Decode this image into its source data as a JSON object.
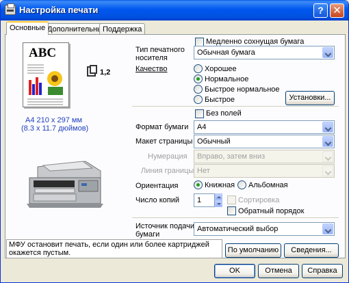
{
  "window": {
    "title": "Настройка печати",
    "help_glyph": "?",
    "close_glyph": "✕"
  },
  "tabs": [
    {
      "label": "Основные",
      "active": true
    },
    {
      "label": "Дополнительные",
      "active": false
    },
    {
      "label": "Поддержка",
      "active": false
    }
  ],
  "preview": {
    "page_text": "ABC",
    "copies_label": "1,2",
    "paper_size_mm": "A4 210 x 297 мм",
    "paper_size_in": "(8.3 x 11.7 дюймов)"
  },
  "settings": {
    "slow_dry": {
      "label": "Медленно сохнущая бумага",
      "checked": false
    },
    "media_type": {
      "label_line1": "Тип печатного",
      "label_line2": "носителя",
      "value": "Обычная бумага"
    },
    "quality": {
      "label": "Качество",
      "options": [
        "Хорошее",
        "Нормальное",
        "Быстрое нормальное",
        "Быстрое"
      ],
      "selected": "Нормальное",
      "settings_button": "Установки..."
    },
    "borderless": {
      "label": "Без полей",
      "checked": false
    },
    "paper_size": {
      "label": "Формат бумаги",
      "value": "A4"
    },
    "page_layout": {
      "label": "Макет страницы",
      "value": "Обычный"
    },
    "page_order": {
      "label": "Нумерация",
      "value": "Вправо, затем вниз"
    },
    "border_line": {
      "label": "Линия границы",
      "value": "Нет"
    },
    "orientation": {
      "label": "Ориентация",
      "options": [
        "Книжная",
        "Альбомная"
      ],
      "selected": "Книжная"
    },
    "copies": {
      "label": "Число копий",
      "value": "1",
      "collate": {
        "label": "Сортировка",
        "checked": false
      },
      "reverse": {
        "label": "Обратный порядок",
        "checked": false
      }
    },
    "paper_source": {
      "label_line1": "Источник подачи",
      "label_line2": "бумаги",
      "value": "Автоматический выбор"
    }
  },
  "status_message": "МФУ остановит печать, если один или более картриджей окажется пустым.",
  "buttons": {
    "default": "По умолчанию",
    "info": "Сведения...",
    "ok": "OK",
    "cancel": "Отмена",
    "help": "Справка"
  },
  "colors": {
    "title_bar": "#0058EE",
    "dialog_bg": "#ECE9D8",
    "radio_dot": "#21A121",
    "link_text": "#1F3FBF"
  }
}
